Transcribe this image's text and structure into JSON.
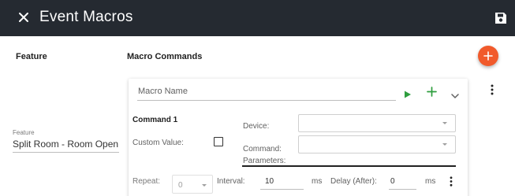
{
  "header": {
    "title": "Event Macros",
    "close_icon": "close-icon",
    "save_icon": "save-icon"
  },
  "columns": {
    "feature": "Feature",
    "macro_commands": "Macro Commands"
  },
  "add_macro_icon": "plus-icon",
  "feature_field": {
    "label": "Feature",
    "value": "Split Room - Room Open"
  },
  "macro": {
    "name_placeholder": "Macro Name",
    "icons": [
      "play-icon",
      "plus-icon",
      "chevron-down-icon",
      "more-vertical-icon"
    ],
    "command": {
      "title": "Command 1",
      "custom_value_label": "Custom Value:",
      "custom_value_checked": false,
      "device_label": "Device:",
      "device_value": "",
      "command_label_line1": "Command:",
      "command_label_line2": "Parameters:",
      "command_value": "",
      "repeat_label": "Repeat:",
      "repeat_value": "0",
      "interval_label": "Interval:",
      "interval_value": "10",
      "interval_unit": "ms",
      "delay_label": "Delay (After):",
      "delay_value": "0",
      "delay_unit": "ms"
    }
  },
  "colors": {
    "header_bg": "#252a31",
    "accent_orange": "#f15a2b",
    "action_green": "#2e9e3e"
  }
}
